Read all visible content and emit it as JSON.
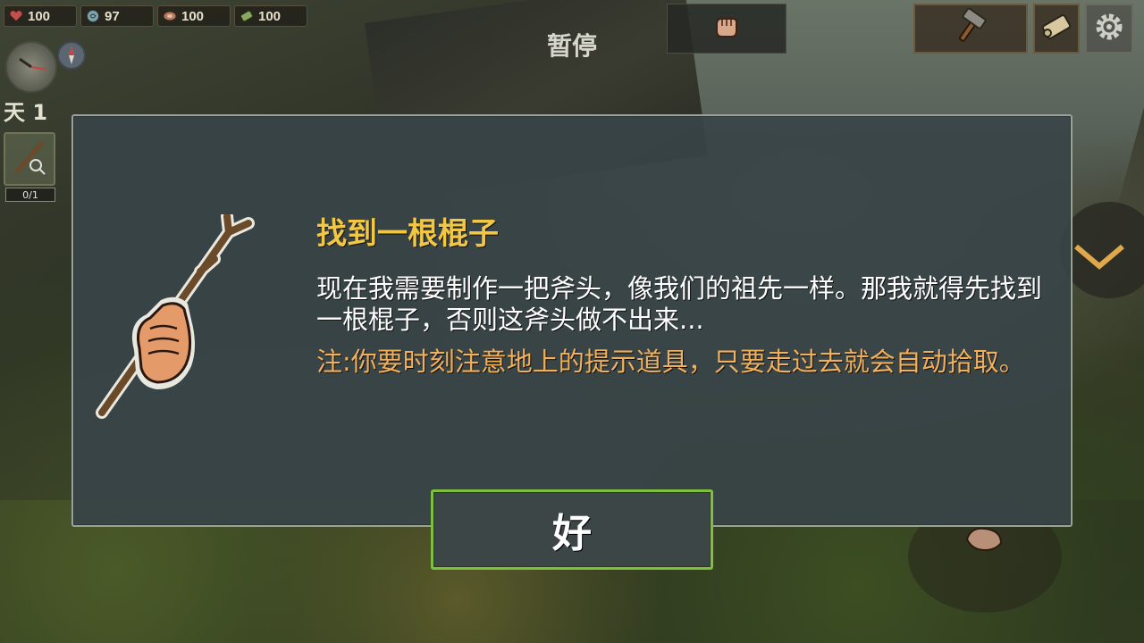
{
  "hud": {
    "stats": [
      {
        "icon": "heart-icon",
        "value": "100",
        "color": "#c0504a"
      },
      {
        "icon": "stomach-icon",
        "value": "97",
        "color": "#8ab0b8"
      },
      {
        "icon": "meat-icon",
        "value": "100",
        "color": "#b87860"
      },
      {
        "icon": "water-icon",
        "value": "100",
        "color": "#8aa860"
      }
    ],
    "pause_label": "暂停",
    "day_label": "天 1",
    "quest_count": "0/1"
  },
  "dialog": {
    "title": "找到一根棍子",
    "body": "现在我需要制作一把斧头，像我们的祖先一样。那我就得先找到一根棍子，否则这斧头做不出来...",
    "note": "注:你要时刻注意地上的提示道具，只要走过去就会自动拾取。",
    "ok_label": "好"
  },
  "colors": {
    "title": "#f2c744",
    "note": "#f2b05a",
    "ok_border": "#7fbf3f"
  }
}
